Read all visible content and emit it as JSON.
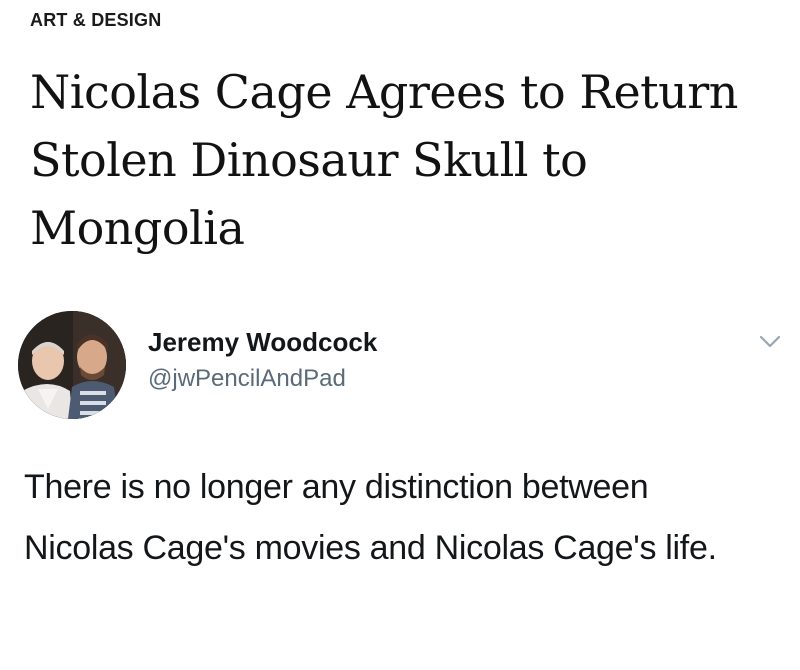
{
  "article": {
    "section": "ART & DESIGN",
    "headline": "Nicolas Cage Agrees to Return Stolen Dinosaur Skull to Mongolia"
  },
  "tweet": {
    "author_name": "Jeremy Woodcock",
    "author_handle": "@jwPencilAndPad",
    "text": "There is no longer any distinction between Nicolas Cage's movies and Nicolas Cage's life.",
    "menu_icon": "chevron-down-icon",
    "avatar_icon": "avatar-photo"
  },
  "colors": {
    "text": "#121212",
    "handle": "#5b6a78",
    "caret": "#9aa5b1",
    "background": "#ffffff"
  }
}
